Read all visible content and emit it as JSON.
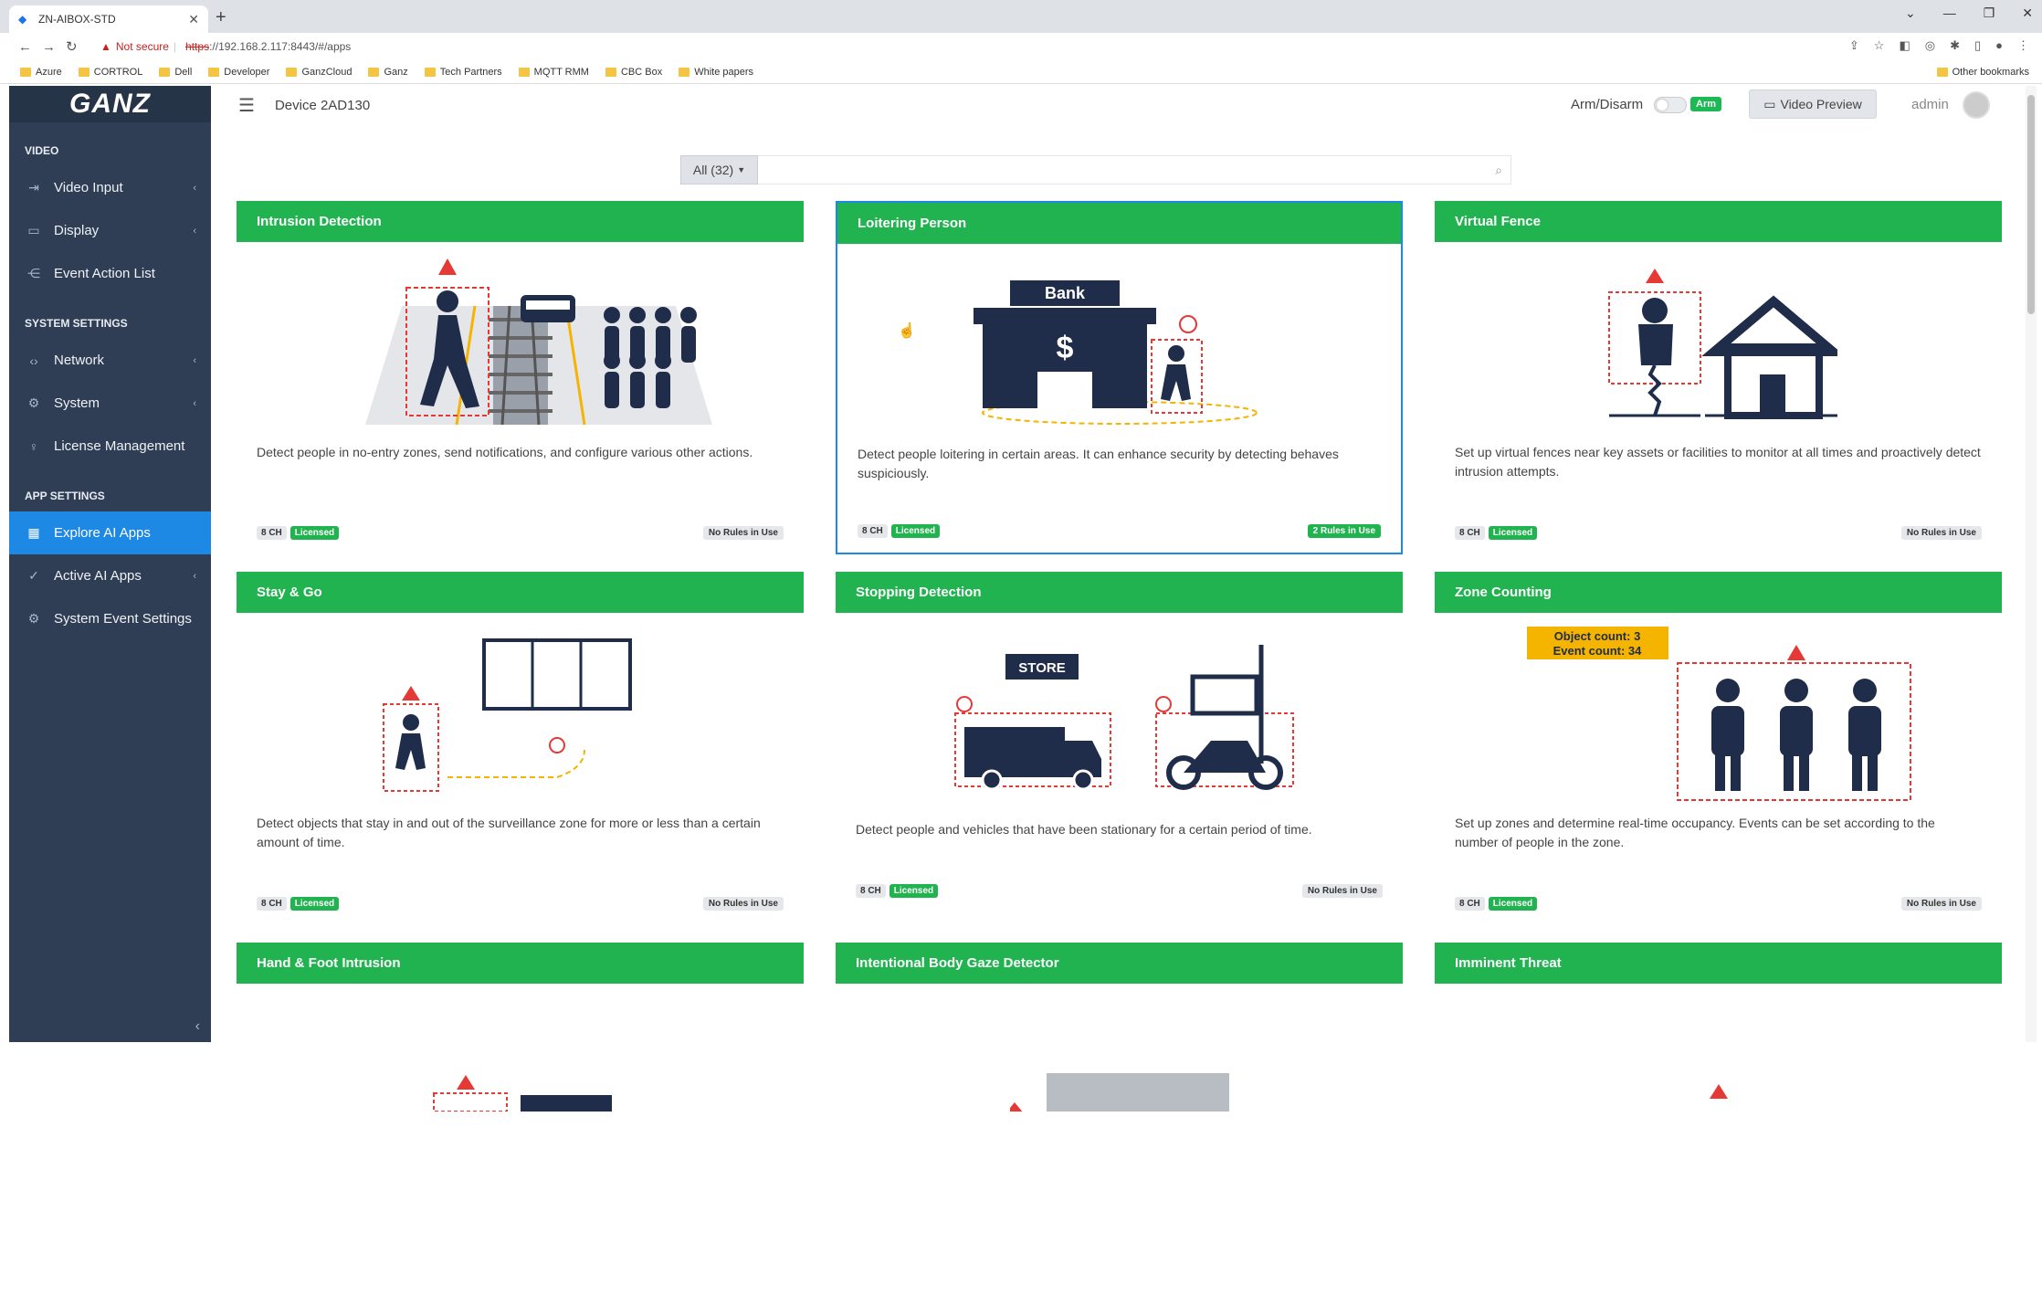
{
  "browser": {
    "tab_title": "ZN-AIBOX-STD",
    "new_tab": "+",
    "not_secure": "Not secure",
    "url_scheme": "https",
    "url_rest": "://192.168.2.117:8443/#/apps",
    "bookmarks": [
      "Azure",
      "CORTROL",
      "Dell",
      "Developer",
      "GanzCloud",
      "Ganz",
      "Tech Partners",
      "MQTT RMM",
      "CBC Box",
      "White papers"
    ],
    "other_bookmarks": "Other bookmarks"
  },
  "sidebar": {
    "logo": "GANZ",
    "sections": [
      {
        "title": "VIDEO",
        "items": [
          {
            "label": "Video Input",
            "icon": "monitor-in-icon",
            "caret": true
          },
          {
            "label": "Display",
            "icon": "display-icon",
            "caret": true
          },
          {
            "label": "Event Action List",
            "icon": "share-icon",
            "caret": false
          }
        ]
      },
      {
        "title": "SYSTEM SETTINGS",
        "items": [
          {
            "label": "Network",
            "icon": "network-icon",
            "caret": true
          },
          {
            "label": "System",
            "icon": "gear-icon",
            "caret": true
          },
          {
            "label": "License Management",
            "icon": "license-icon",
            "caret": false
          }
        ]
      },
      {
        "title": "APP SETTINGS",
        "items": [
          {
            "label": "Explore AI Apps",
            "icon": "grid-icon",
            "caret": false,
            "active": true
          },
          {
            "label": "Active AI Apps",
            "icon": "check-icon",
            "caret": true
          },
          {
            "label": "System Event Settings",
            "icon": "gear-icon",
            "caret": false
          }
        ]
      }
    ]
  },
  "topbar": {
    "device": "Device 2AD130",
    "arm_label": "Arm/Disarm",
    "arm_badge": "Arm",
    "video_preview": "Video Preview",
    "user": "admin"
  },
  "filter": {
    "dropdown": "All (32)",
    "search_value": ""
  },
  "cards": [
    {
      "title": "Intrusion Detection",
      "desc": "Detect people in no-entry zones, send notifications, and configure various other actions.",
      "ch": "8 CH",
      "license": "Licensed",
      "rules": "No Rules in Use",
      "rules_active": false
    },
    {
      "title": "Loitering Person",
      "desc": "Detect people loitering in certain areas. It can enhance security by detecting behaves suspiciously.",
      "ch": "8 CH",
      "license": "Licensed",
      "rules": "2 Rules in Use",
      "rules_active": true,
      "selected": true
    },
    {
      "title": "Virtual Fence",
      "desc": "Set up virtual fences near key assets or facilities to monitor at all times and proactively detect intrusion attempts.",
      "ch": "8 CH",
      "license": "Licensed",
      "rules": "No Rules in Use",
      "rules_active": false
    },
    {
      "title": "Stay & Go",
      "desc": "Detect objects that stay in and out of the surveillance zone for more or less than a certain amount of time.",
      "ch": "8 CH",
      "license": "Licensed",
      "rules": "No Rules in Use",
      "rules_active": false
    },
    {
      "title": "Stopping Detection",
      "desc": "Detect people and vehicles that have been stationary for a certain period of time.",
      "ch": "8 CH",
      "license": "Licensed",
      "rules": "No Rules in Use",
      "rules_active": false
    },
    {
      "title": "Zone Counting",
      "desc": "Set up zones and determine real-time occupancy. Events can be set according to the number of people in the zone.",
      "ch": "8 CH",
      "license": "Licensed",
      "rules": "No Rules in Use",
      "rules_active": false,
      "count_label_1": "Object count: 3",
      "count_label_2": "Event count: 34"
    },
    {
      "title": "Hand & Foot Intrusion",
      "desc": "",
      "ch": "",
      "license": "",
      "rules": ""
    },
    {
      "title": "Intentional Body Gaze Detector",
      "desc": "",
      "ch": "",
      "license": "",
      "rules": ""
    },
    {
      "title": "Imminent Threat",
      "desc": "",
      "ch": "",
      "license": "",
      "rules": ""
    }
  ],
  "bank_label": "Bank",
  "store_label": "STORE"
}
